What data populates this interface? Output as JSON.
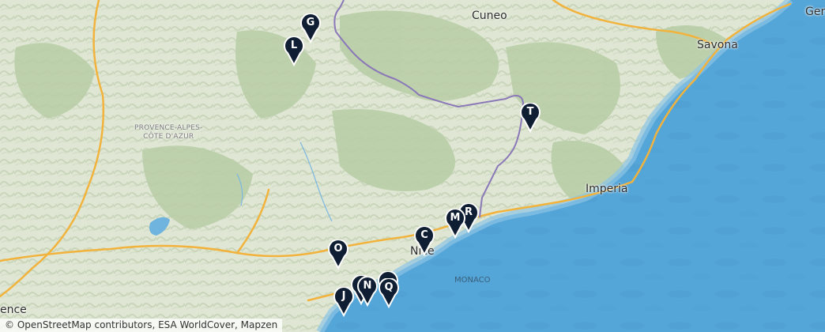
{
  "map": {
    "labels": {
      "cuneo": "Cuneo",
      "savona": "Savona",
      "genova": "Gen",
      "imperia": "Imperia",
      "nice": "Nice",
      "monaco": "MONACO",
      "region_line1": "PROVENCE-ALPES-",
      "region_line2": "CÔTE D'AZUR",
      "provence": "ence"
    },
    "markers": [
      "G",
      "L",
      "T",
      "M",
      "R",
      "C",
      "O",
      "J",
      "N",
      "Q"
    ],
    "attribution": "© OpenStreetMap contributors, ESA WorldCover, Mapzen",
    "colors": {
      "land": "#dfe6d3",
      "forest": "#b5cba3",
      "sea": "#55a6d8",
      "deep_sea": "#4a96cc",
      "road": "#f2b33d",
      "border": "#8a78b8",
      "marker": "#0f1e33"
    }
  }
}
